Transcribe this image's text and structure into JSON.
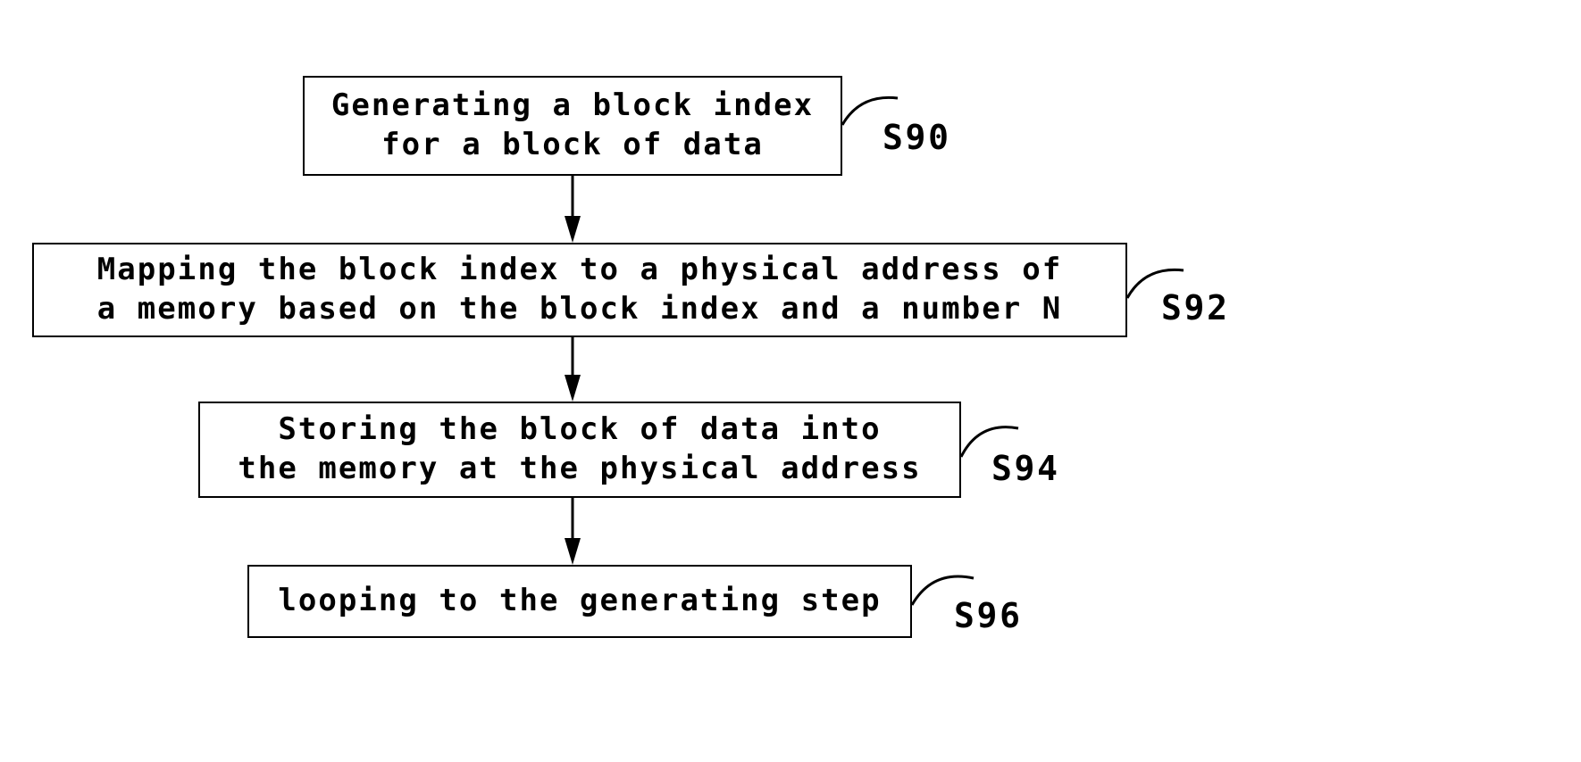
{
  "figure": {
    "type": "flowchart",
    "orientation": "vertical",
    "background_color": "#ffffff",
    "ink_color": "#000000"
  },
  "steps": [
    {
      "id": "S90",
      "ref": "S90",
      "lines": [
        "Generating a block index",
        "for a block of data"
      ]
    },
    {
      "id": "S92",
      "ref": "S92",
      "lines": [
        "Mapping the block index to a physical address of",
        "a memory based on the block index and a number N"
      ]
    },
    {
      "id": "S94",
      "ref": "S94",
      "lines": [
        "Storing the block of data into",
        "the memory at the physical address"
      ]
    },
    {
      "id": "S96",
      "ref": "S96",
      "lines": [
        "looping to the generating step"
      ]
    }
  ],
  "connectors": [
    {
      "from": "S90",
      "to": "S92",
      "style": "arrow-down"
    },
    {
      "from": "S92",
      "to": "S94",
      "style": "arrow-down"
    },
    {
      "from": "S94",
      "to": "S96",
      "style": "arrow-down"
    }
  ],
  "leaders": [
    {
      "for": "S90",
      "style": "curved-hook"
    },
    {
      "for": "S92",
      "style": "curved-hook"
    },
    {
      "for": "S94",
      "style": "curved-hook"
    },
    {
      "for": "S96",
      "style": "curved-hook"
    }
  ]
}
